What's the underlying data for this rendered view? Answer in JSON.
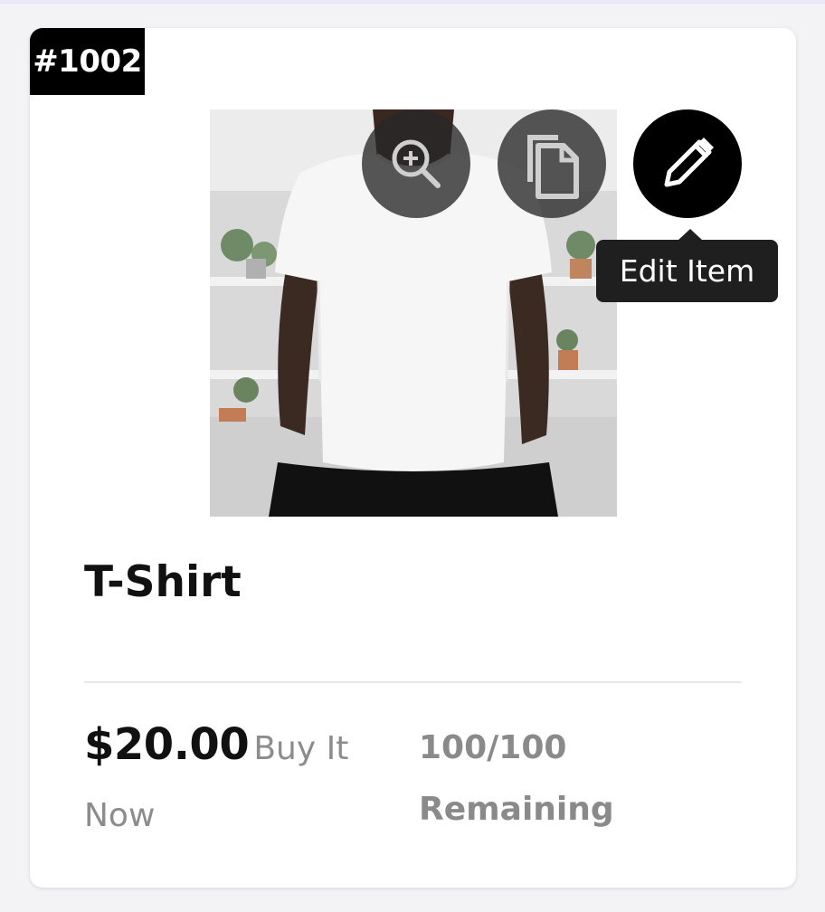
{
  "item": {
    "id_label": "#1002",
    "title": "T-Shirt",
    "price": "$20.00",
    "buy_type": "Buy It Now",
    "stock": "100/100",
    "stock_label": "Remaining"
  },
  "actions": {
    "zoom_icon": "zoom-in-icon",
    "copy_icon": "copy-icon",
    "edit_icon": "pencil-icon",
    "tooltip": "Edit Item"
  },
  "colors": {
    "badge_bg": "#000000",
    "muted_text": "#8c8c8c",
    "edit_button": "#000000"
  }
}
